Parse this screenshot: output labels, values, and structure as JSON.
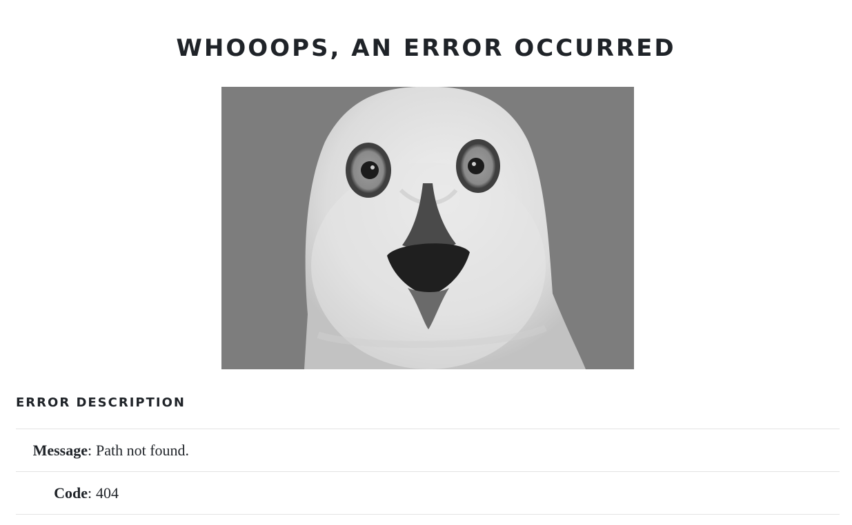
{
  "page": {
    "title": "WHOOOPS, AN ERROR OCCURRED"
  },
  "image": {
    "icon": "snowy-owl-photo",
    "colors": {
      "background": "#7d7d7d",
      "feathers": "#e8e8e8",
      "beak": "#2b2b2b"
    }
  },
  "error_section": {
    "heading": "ERROR DESCRIPTION",
    "separator": ":",
    "rows": [
      {
        "label": "Message",
        "value": "Path not found."
      },
      {
        "label": "Code",
        "value": "404"
      }
    ]
  }
}
